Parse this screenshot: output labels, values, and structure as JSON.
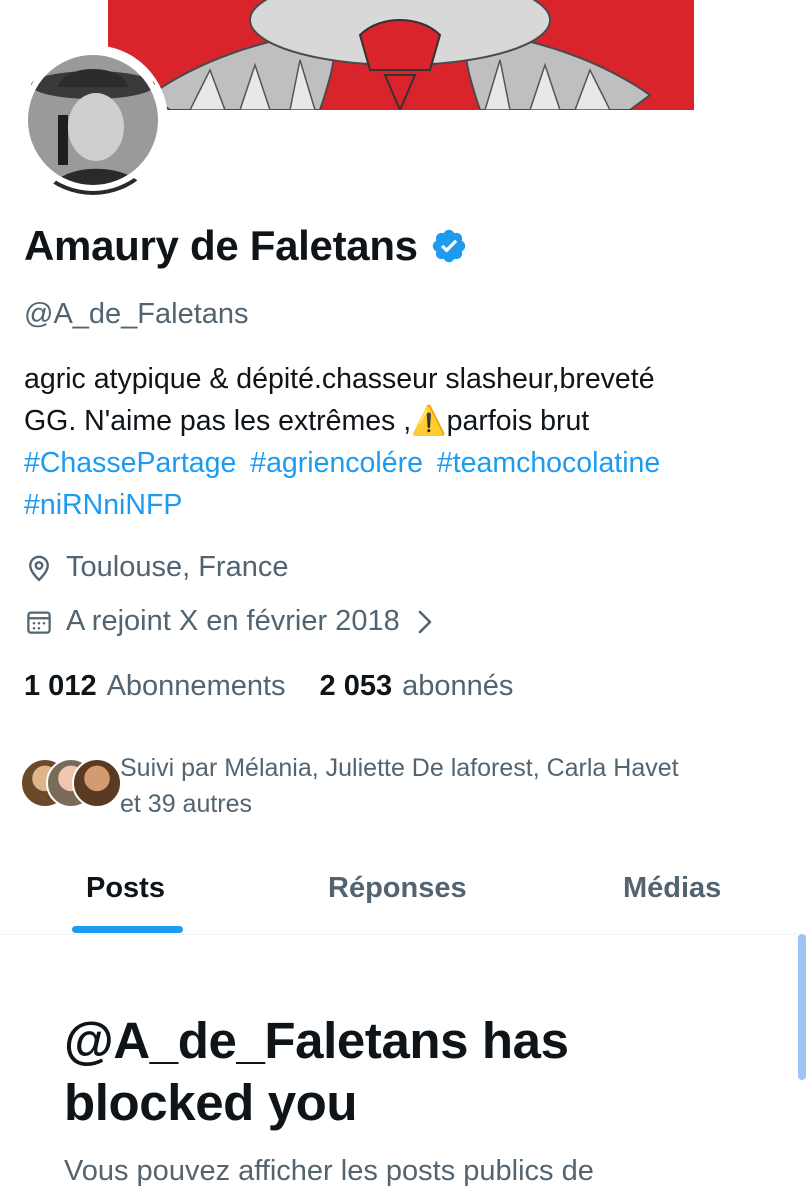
{
  "profile": {
    "name": "Amaury de Faletans",
    "handle": "@A_de_Faletans",
    "bio_line1": "agric atypique & dépité.chasseur slasheur,breveté",
    "bio_line2_before": "GG. N'aime pas les extrêmes ,",
    "bio_line2_emoji": "⚠️",
    "bio_line2_after": "parfois brut",
    "hashtags": [
      "#ChassePartage",
      "#agriencolére",
      "#teamchocolatine",
      "#niRNniNFP"
    ],
    "location": "Toulouse, France",
    "joined": "A rejoint X en février 2018",
    "following_count": "1 012",
    "following_label": "Abonnements",
    "followers_count": "2 053",
    "followers_label": "abonnés",
    "followed_by_line1": "Suivi par Mélania, Juliette De laforest, Carla Havet",
    "followed_by_line2": "et 39 autres"
  },
  "icons": {
    "location": "location-pin-icon",
    "calendar": "calendar-icon",
    "chevron": "chevron-right-icon",
    "verified": "verified-badge-icon"
  },
  "tabs": [
    {
      "label": "Posts",
      "active": true
    },
    {
      "label": "Réponses",
      "active": false
    },
    {
      "label": "Médias",
      "active": false
    }
  ],
  "blocked": {
    "title_line1": "@A_de_Faletans has",
    "title_line2": "blocked you",
    "description": "Vous pouvez afficher les posts publics de"
  },
  "colors": {
    "accent": "#1d9bf0",
    "secondary_text": "#536471",
    "primary_text": "#0f1419",
    "banner_red": "#d9242b"
  }
}
